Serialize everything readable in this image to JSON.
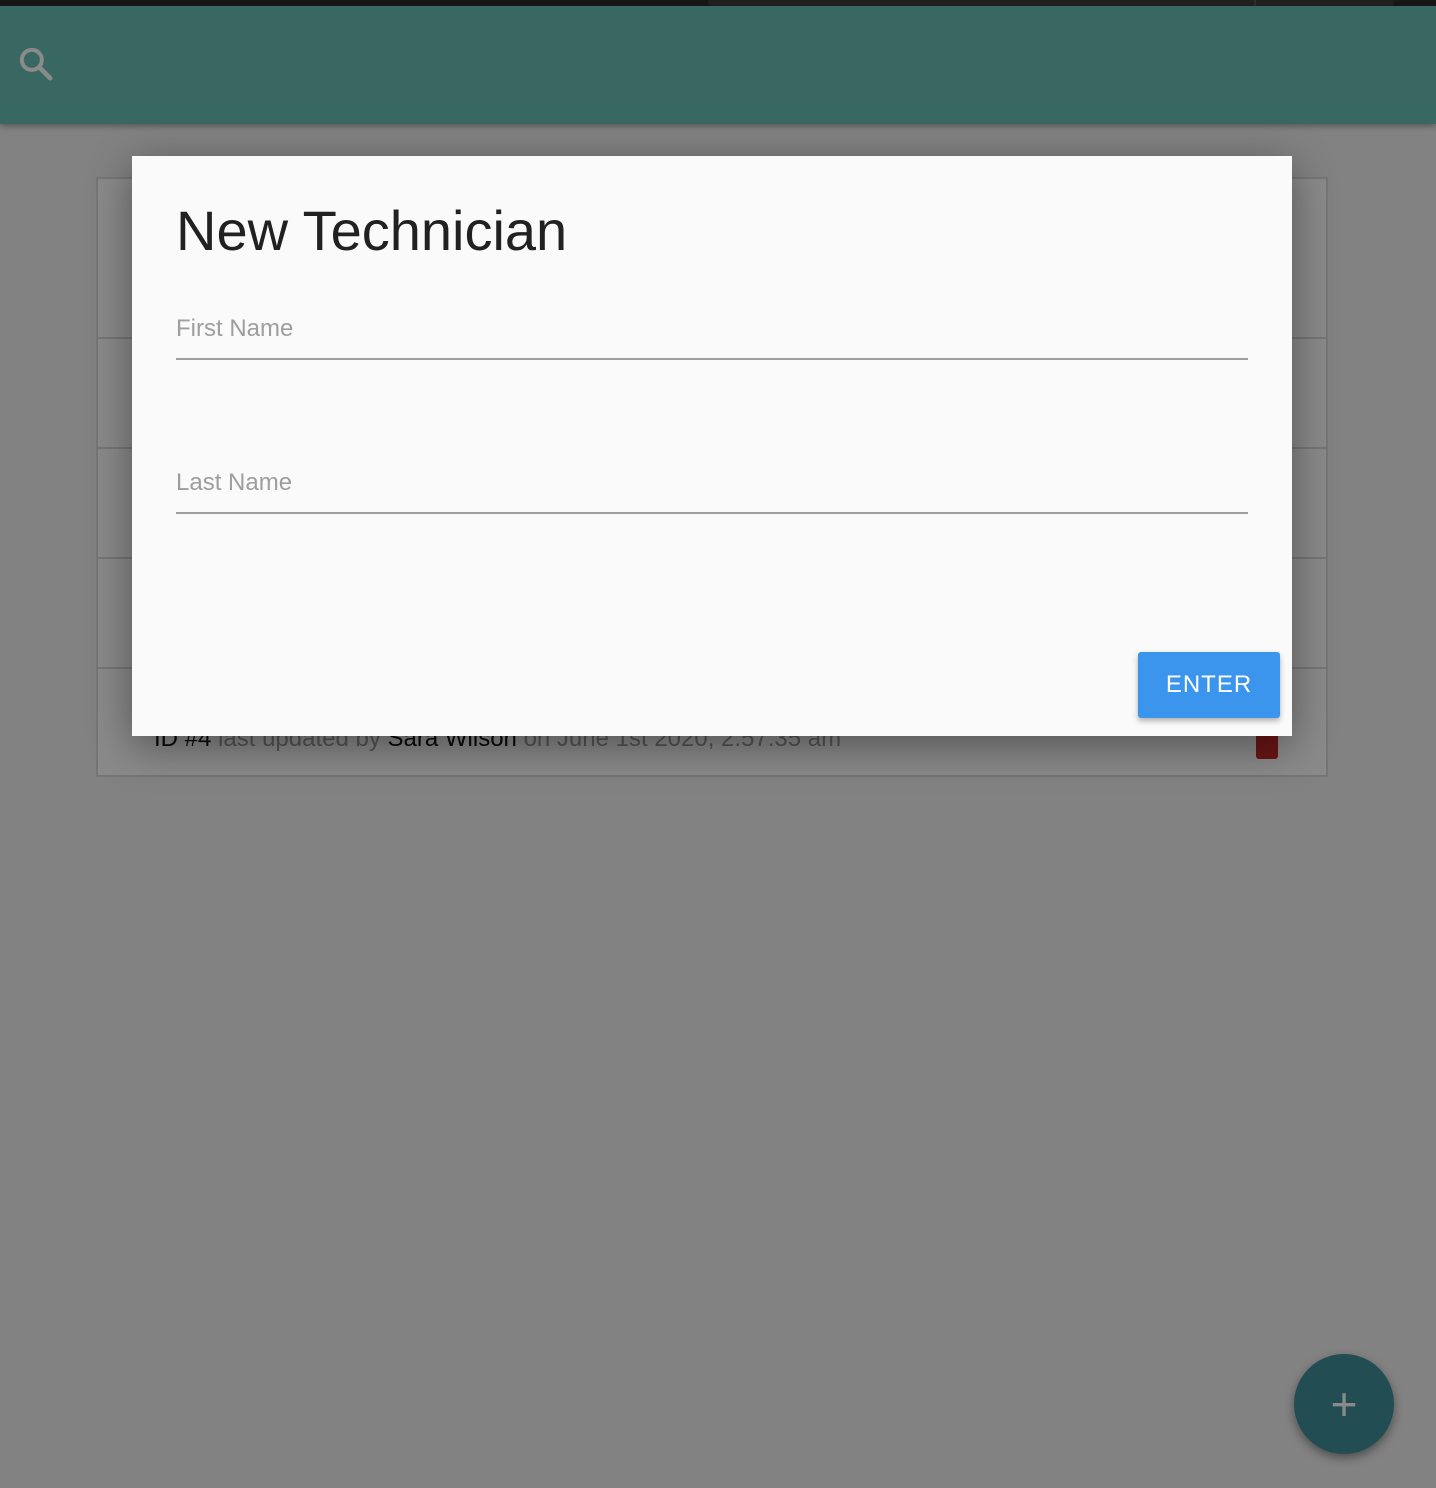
{
  "app_bar": {
    "search_icon": "search-icon",
    "color": "#6abfb4"
  },
  "list": {
    "visible_row": {
      "id_label": "ID #4",
      "middle_text": "last updated by",
      "user": "Sara Wilson",
      "date_text": "on June 1st 2020, 2:57:35 am",
      "flag_color": "#c62828"
    }
  },
  "dialog": {
    "title": "New Technician",
    "first_name_placeholder": "First Name",
    "last_name_placeholder": "Last Name",
    "first_name_value": "",
    "last_name_value": "",
    "enter_label": "ENTER",
    "enter_color": "#3b95ec"
  },
  "fab": {
    "icon": "plus-icon",
    "label": "+",
    "color": "#3d8f9a"
  }
}
